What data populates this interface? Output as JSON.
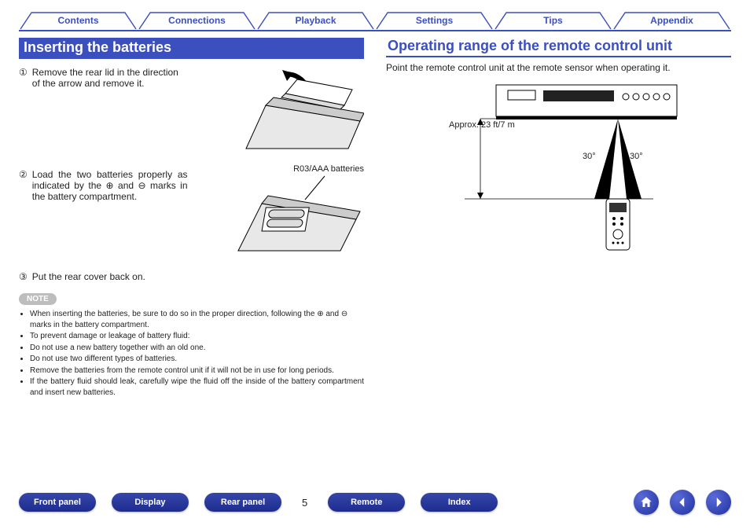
{
  "nav_tabs": [
    "Contents",
    "Connections",
    "Playback",
    "Settings",
    "Tips",
    "Appendix"
  ],
  "left": {
    "heading": "Inserting the batteries",
    "steps": {
      "s1_num": "①",
      "s1": "Remove the rear lid in the direction of the arrow and remove it.",
      "s2_num": "②",
      "s2": "Load the two batteries properly as indicated by the ⊕ and ⊖ marks in the battery compartment.",
      "s2_label": "R03/AAA batteries",
      "s3_num": "③",
      "s3": "Put the rear cover back on."
    },
    "note_label": "NOTE",
    "notes": {
      "n1": "When inserting the batteries, be sure to do so in the proper direction, following the ⊕ and ⊖ marks in the battery compartment.",
      "n2": "To prevent damage or leakage of battery fluid:",
      "n2a": "Do not use a new battery together with an old one.",
      "n2b": "Do not use two different types of batteries.",
      "n3": "Remove the batteries from the remote control unit if it will not be in use for long periods.",
      "n4": "If the battery fluid should leak, carefully wipe the fluid off the inside of the battery compartment and insert new batteries."
    }
  },
  "right": {
    "heading": "Operating range of the remote control unit",
    "intro": "Point the remote control unit at the remote sensor when operating it.",
    "distance": "Approx. 23 ft/7 m",
    "angle_left": "30°",
    "angle_right": "30°"
  },
  "footer": {
    "buttons": [
      "Front panel",
      "Display",
      "Rear panel",
      "Remote",
      "Index"
    ],
    "page": "5"
  }
}
